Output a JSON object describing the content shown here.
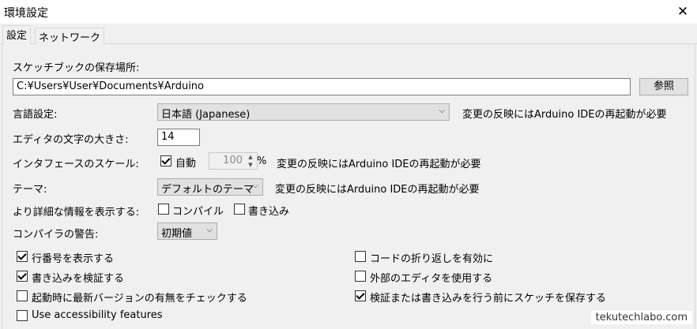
{
  "window": {
    "title": "環境設定",
    "close_glyph": "✕"
  },
  "tabs": [
    {
      "label": "設定",
      "active": true
    },
    {
      "label": "ネットワーク",
      "active": false
    }
  ],
  "sketchbook": {
    "label": "スケッチブックの保存場所:",
    "path": "C:¥Users¥User¥Documents¥Arduino",
    "browse_button": "参照"
  },
  "language": {
    "label": "言語設定:",
    "selected": "日本語 (Japanese)",
    "note": "変更の反映にはArduino IDEの再起動が必要"
  },
  "font_size": {
    "label": "エディタの文字の大きさ:",
    "value": "14"
  },
  "scale": {
    "label": "インタフェースのスケール:",
    "auto_label": "自動",
    "auto_checked": true,
    "value": "100",
    "unit": "%",
    "note": "変更の反映にはArduino IDEの再起動が必要"
  },
  "theme": {
    "label": "テーマ:",
    "selected": "デフォルトのテーマ",
    "note": "変更の反映にはArduino IDEの再起動が必要"
  },
  "verbose": {
    "label": "より詳細な情報を表示する:",
    "compile_label": "コンパイル",
    "compile_checked": false,
    "upload_label": "書き込み",
    "upload_checked": false
  },
  "warnings": {
    "label": "コンパイラの警告:",
    "selected": "初期値"
  },
  "options": {
    "left": [
      {
        "label": "行番号を表示する",
        "checked": true
      },
      {
        "label": "書き込みを検証する",
        "checked": true
      },
      {
        "label": "起動時に最新バージョンの有無をチェックする",
        "checked": false
      },
      {
        "label": "Use accessibility features",
        "checked": false
      }
    ],
    "right": [
      {
        "label": "コードの折り返しを有効に",
        "checked": false
      },
      {
        "label": "外部のエディタを使用する",
        "checked": false
      },
      {
        "label": "検証または書き込みを行う前にスケッチを保存する",
        "checked": true
      }
    ]
  },
  "watermark": "tekutechlabo.com",
  "icons": {
    "close": "close-icon",
    "dropdown": "chevron-down-icon",
    "spin_up": "spin-up-icon",
    "spin_down": "spin-down-icon"
  }
}
